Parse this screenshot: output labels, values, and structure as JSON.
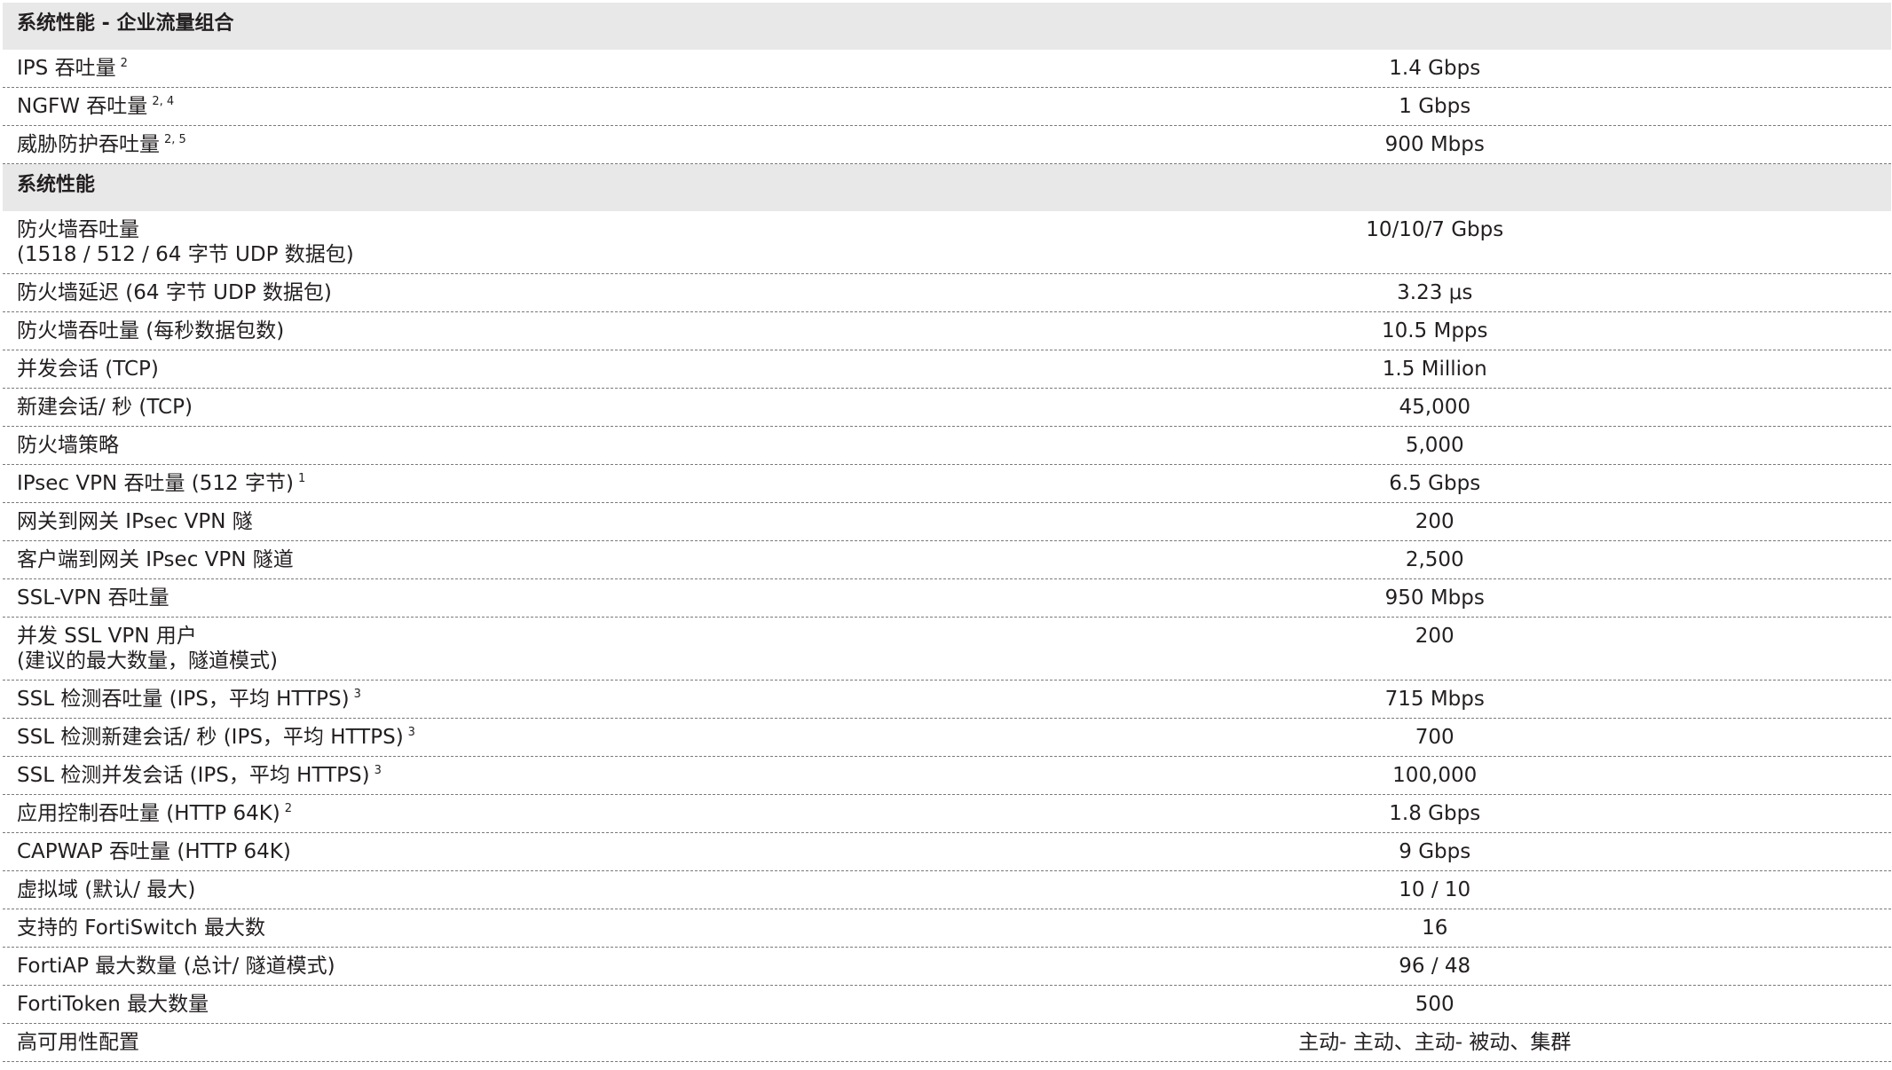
{
  "sections": [
    {
      "title": "系统性能 - 企业流量组合",
      "rows": [
        {
          "label": [
            "IPS 吞吐量"
          ],
          "sup": "2",
          "value": "1.4 Gbps"
        },
        {
          "label": [
            "NGFW 吞吐量"
          ],
          "sup": "2, 4",
          "value": "1 Gbps"
        },
        {
          "label": [
            "威胁防护吞吐量"
          ],
          "sup": "2, 5",
          "value": "900 Mbps"
        }
      ]
    },
    {
      "title": "系统性能",
      "rows": [
        {
          "label": [
            "防火墙吞吐量",
            "(1518 / 512 / 64 字节 UDP 数据包)"
          ],
          "sup": "",
          "value": "10/10/7 Gbps"
        },
        {
          "label": [
            "防火墙延迟 (64 字节 UDP 数据包)"
          ],
          "sup": "",
          "value": "3.23 μs"
        },
        {
          "label": [
            "防火墙吞吐量 (每秒数据包数)"
          ],
          "sup": "",
          "value": "10.5 Mpps"
        },
        {
          "label": [
            "并发会话 (TCP)"
          ],
          "sup": "",
          "value": "1.5 Million"
        },
        {
          "label": [
            "新建会话/ 秒 (TCP)"
          ],
          "sup": "",
          "value": "45,000"
        },
        {
          "label": [
            "防火墙策略"
          ],
          "sup": "",
          "value": "5,000"
        },
        {
          "label": [
            "IPsec VPN 吞吐量 (512 字节)"
          ],
          "sup": "1",
          "value": "6.5 Gbps"
        },
        {
          "label": [
            "网关到网关 IPsec VPN 隧"
          ],
          "sup": "",
          "value": "200"
        },
        {
          "label": [
            "客户端到网关 IPsec VPN 隧道"
          ],
          "sup": "",
          "value": "2,500"
        },
        {
          "label": [
            "SSL-VPN 吞吐量"
          ],
          "sup": "",
          "value": "950 Mbps"
        },
        {
          "label": [
            "并发 SSL VPN 用户",
            "(建议的最大数量，隧道模式)"
          ],
          "sup": "",
          "value": "200"
        },
        {
          "label": [
            "SSL 检测吞吐量 (IPS，平均 HTTPS)"
          ],
          "sup": "3",
          "value": "715 Mbps"
        },
        {
          "label": [
            "SSL 检测新建会话/ 秒 (IPS，平均 HTTPS)"
          ],
          "sup": "3",
          "value": "700"
        },
        {
          "label": [
            "SSL 检测并发会话 (IPS，平均 HTTPS)"
          ],
          "sup": "3",
          "value": "100,000"
        },
        {
          "label": [
            "应用控制吞吐量 (HTTP 64K)"
          ],
          "sup": "2",
          "value": "1.8 Gbps"
        },
        {
          "label": [
            "CAPWAP 吞吐量 (HTTP 64K)"
          ],
          "sup": "",
          "value": "9 Gbps"
        },
        {
          "label": [
            "虚拟域 (默认/ 最大)"
          ],
          "sup": "",
          "value": "10 / 10"
        },
        {
          "label": [
            "支持的 FortiSwitch 最大数"
          ],
          "sup": "",
          "value": "16"
        },
        {
          "label": [
            "FortiAP 最大数量 (总计/ 隧道模式)"
          ],
          "sup": "",
          "value": "96 / 48"
        },
        {
          "label": [
            "FortiToken 最大数量"
          ],
          "sup": "",
          "value": "500"
        },
        {
          "label": [
            "高可用性配置"
          ],
          "sup": "",
          "value": "主动- 主动、主动- 被动、集群"
        }
      ]
    }
  ]
}
